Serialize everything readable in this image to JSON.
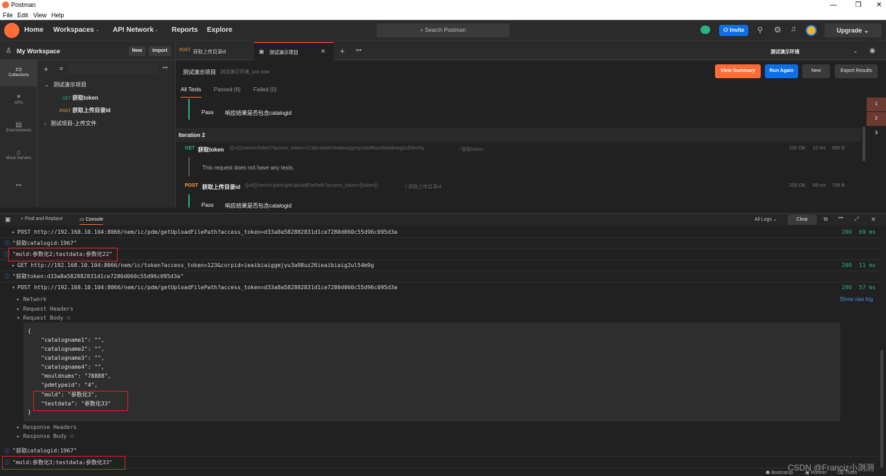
{
  "window": {
    "title": "Postman",
    "menu": [
      "File",
      "Edit",
      "View",
      "Help"
    ]
  },
  "topnav": {
    "items": [
      "Home",
      "Workspaces",
      "API Network",
      "Reports",
      "Explore"
    ],
    "search_placeholder": "Search Postman",
    "invite": "Invite",
    "upgrade": "Upgrade"
  },
  "workspace": {
    "name": "My Workspace",
    "new_label": "New",
    "import_label": "Import"
  },
  "tabs": [
    {
      "method": "POST",
      "label": "获取上传目录id"
    },
    {
      "method": "",
      "label": "测试演示项目"
    }
  ],
  "environment": "测试演示环境",
  "rail": [
    "Collections",
    "APIs",
    "Environments",
    "Mock Servers"
  ],
  "collections": {
    "tree": [
      {
        "label": "测试演示项目",
        "expanded": true
      },
      {
        "method": "GET",
        "label": "获取token"
      },
      {
        "method": "POST",
        "label": "获取上传目录id"
      },
      {
        "label": "测试项目-上传文件",
        "expanded": false
      }
    ]
  },
  "runner": {
    "title": "测试演示项目",
    "subtitle": "测试演示环境, just now",
    "view_summary": "View Summary",
    "run_again": "Run Again",
    "new_label": "New",
    "export_label": "Export Results",
    "filters": [
      "All Tests",
      "Passed (6)",
      "Failed (0)"
    ],
    "pass_label": "Pass",
    "pass_desc": "响应结果是否包含catalogid",
    "iteration": "Iteration 2",
    "get_req": {
      "method": "GET",
      "name": "获取token",
      "url": "{{url}}/nem/ic/token?access_token=123&corpid=ieaibiaiggmjyu3a98uz26ieaibiaig2ul54m9g",
      "path": "/ 获取token",
      "status": "200 OK",
      "time": "12 ms",
      "size": "660 B"
    },
    "no_tests": "This request does not have any tests.",
    "post_req": {
      "method": "POST",
      "name": "获取上传目录id",
      "url": "{{url}}/nem/ic/pdm/getUploadFilePath?access_token={{token}}",
      "path": "/ 获取上传目录id",
      "status": "200 OK",
      "time": "69 ms",
      "size": "708 B"
    },
    "iterations": [
      "1",
      "2",
      "3"
    ]
  },
  "console_header": {
    "find_replace": "Find and Replace",
    "console": "Console",
    "all_logs": "All Logs",
    "clear": "Clear"
  },
  "console": {
    "line1": "POST http://192.168.10.104:8066/nem/ic/pdm/getUploadFilePath?access_token=d33a8a582882831d1ce7280d060c55d96c095d3a",
    "line1_status": "200",
    "line1_time": "69 ms",
    "line2": "\"获取catalogid:1967\"",
    "line3": "\"mold:参数化2;testdata:参数化22\"",
    "line4": "GET http://192.168.10.104:8066/nem/ic/token?access_token=123&corpid=ieaibiaiggmjyu3a98uz26ieaibiaig2ul54m9g",
    "line4_status": "200",
    "line4_time": "11 ms",
    "line5": "\"获取token:d33a8a582882831d1ce7280d060c55d96c095d3a\"",
    "line6": "POST http://192.168.10.104:8066/nem/ic/pdm/getUploadFilePath?access_token=d33a8a582882831d1ce7280d060c55d96c095d3a",
    "line6_status": "200",
    "line6_time": "57 ms",
    "show_raw": "Show raw log",
    "network": "Network",
    "req_headers": "Request Headers",
    "req_body": "Request Body",
    "body_lines": [
      "{",
      "    \"catalogname1\": \"\",",
      "    \"catalogname2\": \"\",",
      "    \"catalogname3\": \"\",",
      "    \"catalogname4\": \"\",",
      "    \"mouldnums\": \"78888\",",
      "    \"pdmtypeid\": \"4\",",
      "    \"mold\": \"参数化3\",",
      "    \"testdata\": \"参数化33\"",
      "}"
    ],
    "resp_headers": "Response Headers",
    "resp_body": "Response Body",
    "line7": "\"获取catalogid:1967\"",
    "line8": "\"mold:参数化3;testdata:参数化33\""
  },
  "footer": {
    "watermark": "CSDN @Franciz小测测",
    "bootcamp": "Bootcamp",
    "runner": "Runner",
    "trash": "Trash"
  }
}
